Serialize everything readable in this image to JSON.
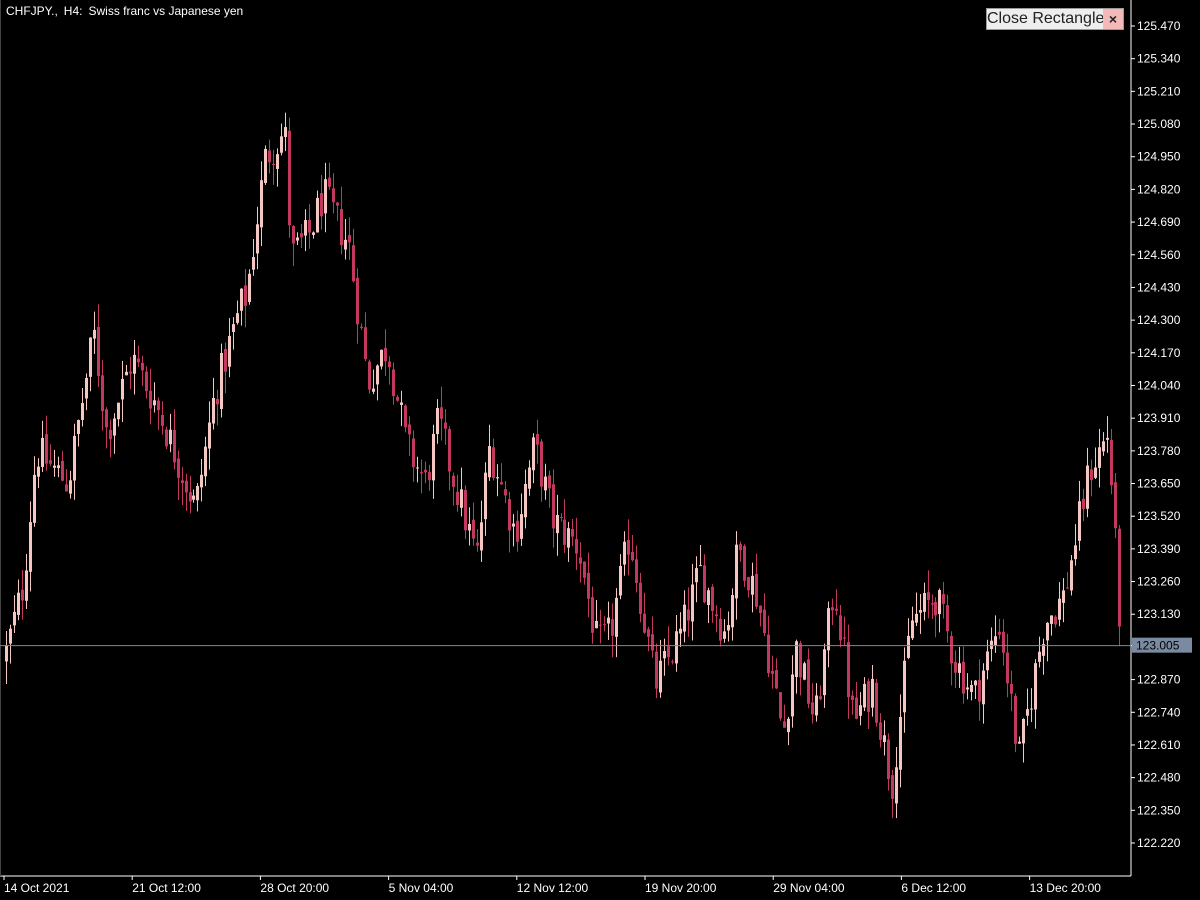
{
  "header": {
    "symbol": "CHFJPY.,",
    "timeframe": "H4:",
    "description": "Swiss franc vs Japanese yen"
  },
  "close_button": {
    "label": "Close Rectangle",
    "close_glyph": "×"
  },
  "current_price": "123.005",
  "colors": {
    "background": "#000000",
    "bull": "#f4c7c3",
    "bear": "#c2385e",
    "axis": "#ffffff",
    "price_line": "#7a8aa0",
    "price_tag_bg": "#7a8aa0"
  },
  "chart_data": {
    "type": "candlestick",
    "price_axis_labels": [
      "125.470",
      "125.340",
      "125.210",
      "125.080",
      "124.950",
      "124.820",
      "124.690",
      "124.560",
      "124.430",
      "124.300",
      "124.170",
      "124.040",
      "123.910",
      "123.780",
      "123.650",
      "123.520",
      "123.390",
      "123.260",
      "123.130",
      "123.005",
      "122.870",
      "122.740",
      "122.610",
      "122.480",
      "122.350",
      "122.220"
    ],
    "ylim": [
      122.12,
      125.57
    ],
    "time_axis_labels": [
      "14 Oct 2021",
      "21 Oct 12:00",
      "28 Oct 20:00",
      "5 Nov 04:00",
      "12 Nov 12:00",
      "19 Nov 20:00",
      "29 Nov 04:00",
      "6 Dec 12:00",
      "13 Dec 20:00"
    ],
    "bar_count": 280,
    "anchors": [
      [
        0,
        122.95
      ],
      [
        6,
        123.25
      ],
      [
        10,
        123.78
      ],
      [
        20,
        123.65
      ],
      [
        28,
        124.25
      ],
      [
        32,
        123.85
      ],
      [
        40,
        124.15
      ],
      [
        48,
        123.95
      ],
      [
        60,
        123.55
      ],
      [
        66,
        124.0
      ],
      [
        74,
        124.35
      ],
      [
        76,
        124.4
      ],
      [
        82,
        124.95
      ],
      [
        88,
        125.05
      ],
      [
        90,
        124.55
      ],
      [
        96,
        124.65
      ],
      [
        100,
        124.8
      ],
      [
        108,
        124.6
      ],
      [
        114,
        124.05
      ],
      [
        120,
        124.2
      ],
      [
        126,
        123.8
      ],
      [
        132,
        123.65
      ],
      [
        136,
        123.9
      ],
      [
        140,
        123.7
      ],
      [
        148,
        123.35
      ],
      [
        152,
        123.8
      ],
      [
        160,
        123.45
      ],
      [
        166,
        123.8
      ],
      [
        172,
        123.5
      ],
      [
        180,
        123.4
      ],
      [
        186,
        123.0
      ],
      [
        190,
        123.05
      ],
      [
        196,
        123.45
      ],
      [
        204,
        122.85
      ],
      [
        212,
        123.05
      ],
      [
        218,
        123.3
      ],
      [
        226,
        123.05
      ],
      [
        230,
        123.4
      ],
      [
        236,
        123.2
      ],
      [
        244,
        122.65
      ],
      [
        248,
        123.0
      ],
      [
        254,
        122.7
      ],
      [
        260,
        123.25
      ],
      [
        266,
        122.7
      ],
      [
        272,
        122.85
      ],
      [
        278,
        122.45
      ],
      [
        284,
        123.1
      ],
      [
        292,
        123.2
      ],
      [
        298,
        122.95
      ],
      [
        304,
        122.8
      ],
      [
        312,
        123.1
      ],
      [
        318,
        122.55
      ],
      [
        326,
        123.1
      ],
      [
        332,
        123.2
      ],
      [
        336,
        123.45
      ],
      [
        340,
        123.7
      ],
      [
        346,
        123.85
      ],
      [
        350,
        123.0
      ]
    ]
  }
}
